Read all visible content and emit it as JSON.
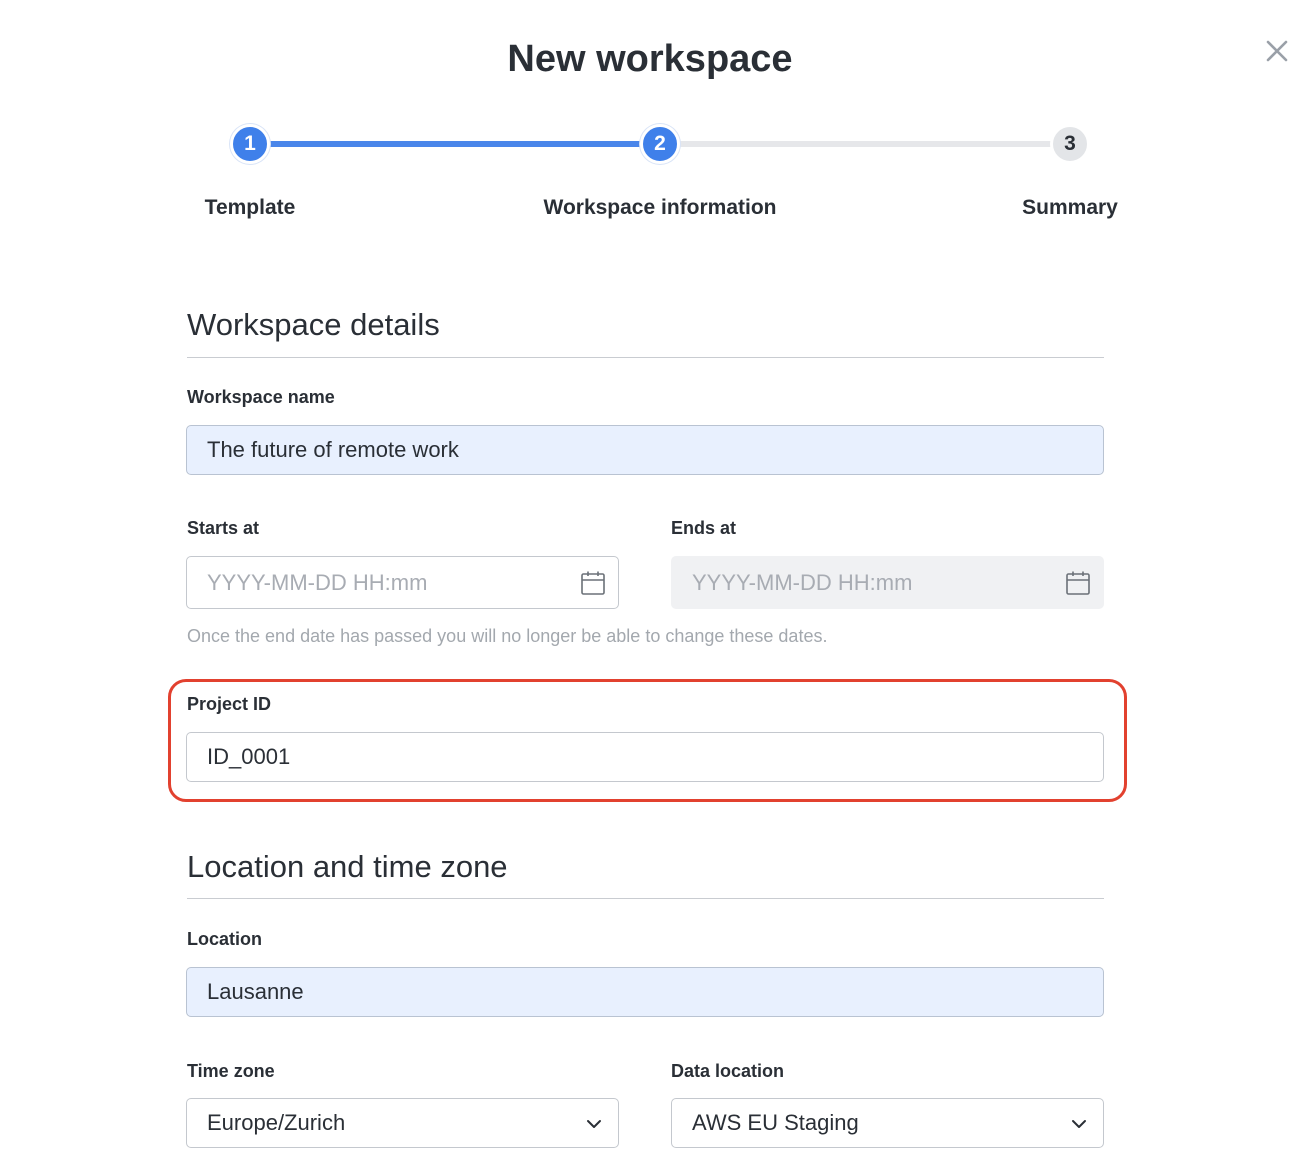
{
  "dialog": {
    "title": "New workspace"
  },
  "stepper": {
    "steps": [
      {
        "number": "1",
        "label": "Template",
        "state": "active"
      },
      {
        "number": "2",
        "label": "Workspace information",
        "state": "active"
      },
      {
        "number": "3",
        "label": "Summary",
        "state": "inactive"
      }
    ]
  },
  "workspace_details": {
    "title": "Workspace details",
    "name_label": "Workspace name",
    "name_value": "The future of remote work",
    "starts_label": "Starts at",
    "starts_placeholder": "YYYY-MM-DD HH:mm",
    "ends_label": "Ends at",
    "ends_placeholder": "YYYY-MM-DD HH:mm",
    "dates_hint": "Once the end date has passed you will no longer be able to change these dates.",
    "project_id_label": "Project ID",
    "project_id_value": "ID_0001"
  },
  "location_section": {
    "title": "Location and time zone",
    "location_label": "Location",
    "location_value": "Lausanne",
    "timezone_label": "Time zone",
    "timezone_value": "Europe/Zurich",
    "data_location_label": "Data location",
    "data_location_value": "AWS EU Staging"
  },
  "colors": {
    "accent": "#3f80ea",
    "highlight": "#e2412f",
    "filled_field": "#e8f0fe"
  },
  "icons": [
    "close-icon",
    "calendar-icon",
    "chevron-down-icon"
  ]
}
